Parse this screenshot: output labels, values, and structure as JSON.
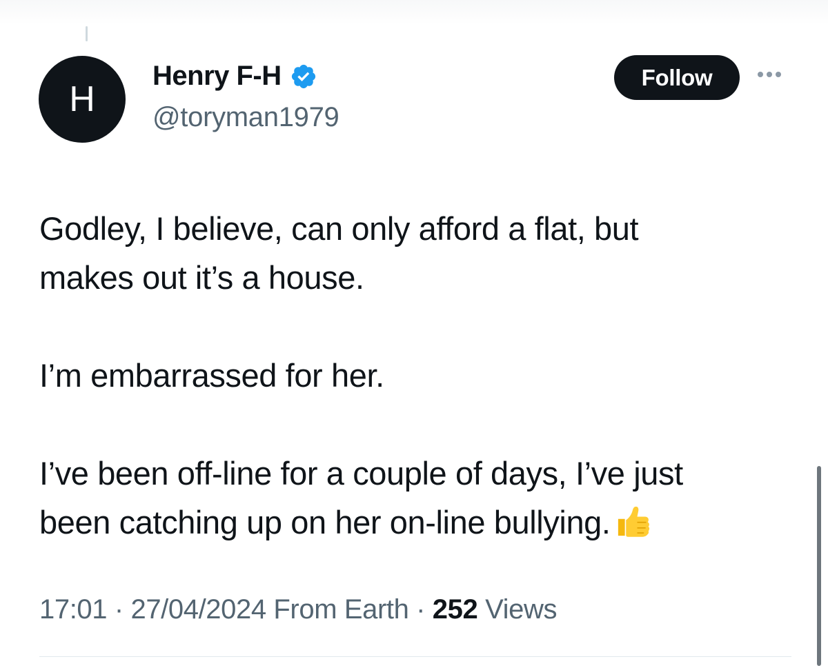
{
  "tweet": {
    "author": {
      "avatar_letter": "H",
      "display_name": "Henry F-H",
      "handle": "@toryman1979",
      "verified": true
    },
    "follow_label": "Follow",
    "body": {
      "line1": "Godley, I believe, can only afford a flat, but",
      "line2": "makes out it’s a house.",
      "para2": "I’m embarrassed for her.",
      "line3": "I’ve been off-line for a couple of days, I’ve just",
      "line4": "been catching up on her on-line bullying.",
      "emoji": "thumbs-up-icon"
    },
    "meta": {
      "time": "17:01",
      "date": "27/04/2024",
      "location": "From Earth",
      "separator": "·",
      "views_count": "252",
      "views_label": "Views"
    }
  },
  "colors": {
    "text_primary": "#0f1419",
    "text_secondary": "#536471",
    "verified_blue": "#1d9bf0",
    "follow_bg": "#0f1419"
  }
}
